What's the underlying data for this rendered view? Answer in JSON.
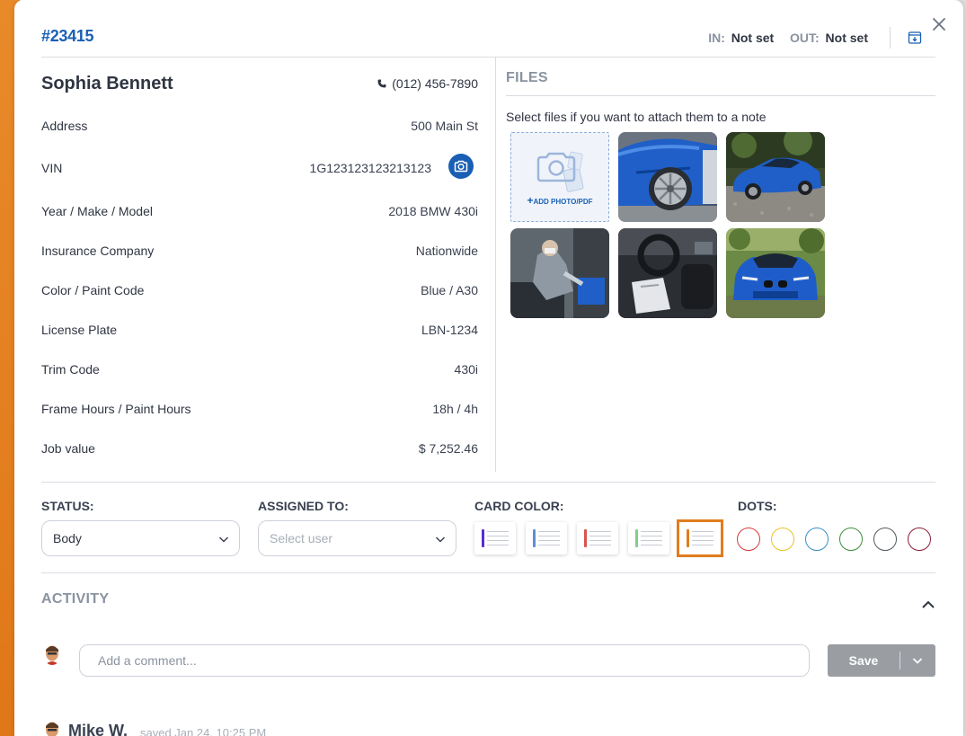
{
  "header": {
    "job_id": "#23415",
    "in_label": "IN:",
    "in_value": "Not set",
    "out_label": "OUT:",
    "out_value": "Not set",
    "icons": [
      "archive-icon",
      "close-icon"
    ]
  },
  "customer": {
    "name": "Sophia Bennett",
    "phone": "(012) 456-7890"
  },
  "details": [
    {
      "label": "Address",
      "value": "500 Main St"
    },
    {
      "label": "VIN",
      "value": "1G123123123213123"
    },
    {
      "label": "Year / Make / Model",
      "value": "2018  BMW  430i"
    },
    {
      "label": "Insurance Company",
      "value": "Nationwide"
    },
    {
      "label": "Color / Paint Code",
      "value": "Blue  /  A30"
    },
    {
      "label": "License Plate",
      "value": "LBN-1234"
    },
    {
      "label": "Trim Code",
      "value": "430i"
    },
    {
      "label": "Frame Hours / Paint Hours",
      "value": "18h  /  4h"
    },
    {
      "label": "Job value",
      "value": "$ 7,252.46"
    }
  ],
  "files": {
    "title": "FILES",
    "subtitle": "Select files if you want to attach them to a note",
    "add_label": "ADD PHOTO/PDF",
    "thumbnails": [
      "car-wheel-photo",
      "car-side-photo",
      "technician-photo",
      "car-interior-photo",
      "car-front-photo"
    ]
  },
  "controls": {
    "status_label": "STATUS:",
    "status_value": "Body",
    "assigned_label": "ASSIGNED TO:",
    "assigned_placeholder": "Select user",
    "card_color_label": "CARD COLOR:",
    "card_colors": [
      "#5b2bd1",
      "#5b8fd8",
      "#d9534f",
      "#7fcf8a",
      "#e07d1e"
    ],
    "selected_card_color": 4,
    "dots_label": "DOTS:",
    "dot_colors": [
      "#d63b3b",
      "#e8c42a",
      "#3a8fc9",
      "#3a8f3a",
      "#555a60",
      "#8a1f3a"
    ]
  },
  "activity": {
    "title": "ACTIVITY",
    "comment_placeholder": "Add a comment...",
    "save_label": "Save",
    "entry_name": "Mike W.",
    "entry_meta": "saved Jan 24, 10:25 PM"
  }
}
